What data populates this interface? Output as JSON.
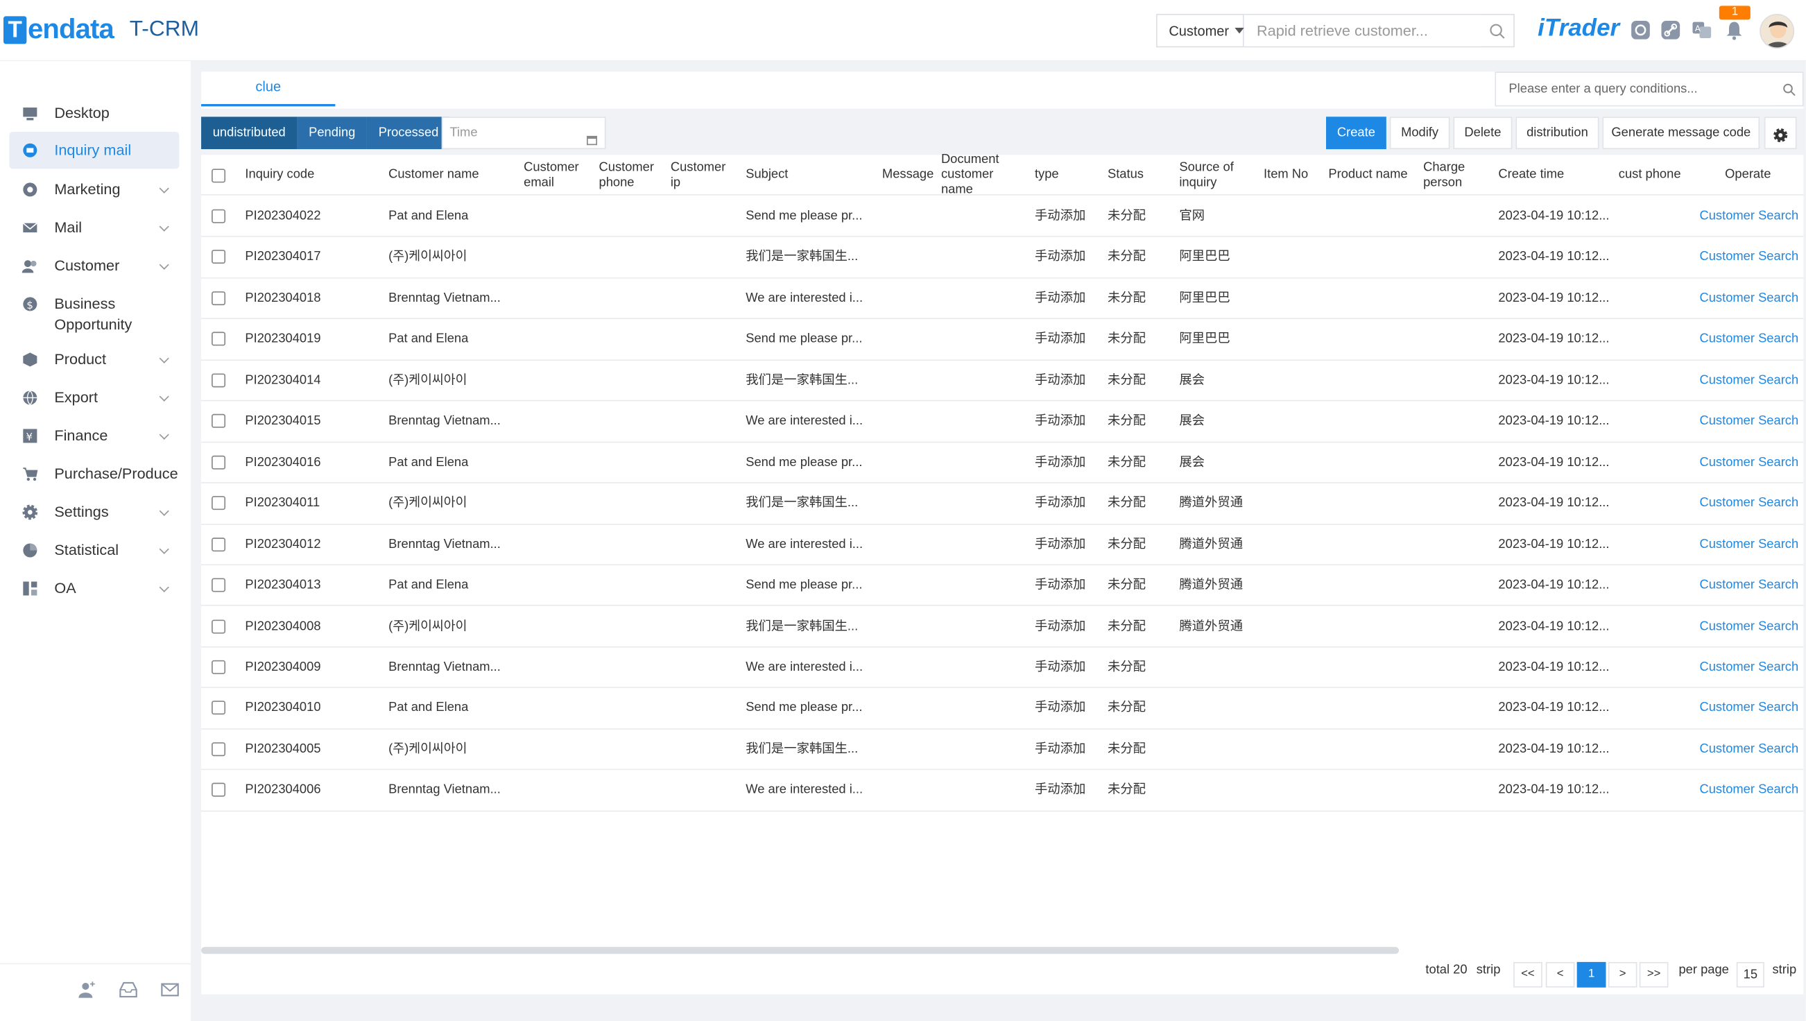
{
  "brand": {
    "logo_letter": "T",
    "logo_rest": "endata",
    "app_title": "T-CRM",
    "itrader": "iTrader",
    "notification_count": "1"
  },
  "search": {
    "type": "Customer",
    "placeholder": "Rapid retrieve customer..."
  },
  "sidebar": {
    "items": [
      {
        "label": "Desktop",
        "icon": "desktop-icon",
        "has_submenu": false
      },
      {
        "label": "Inquiry mail",
        "icon": "inquiry-icon",
        "has_submenu": false,
        "active": true
      },
      {
        "label": "Marketing",
        "icon": "marketing-icon",
        "has_submenu": true
      },
      {
        "label": "Mail",
        "icon": "mail-icon",
        "has_submenu": true
      },
      {
        "label": "Customer",
        "icon": "customer-icon",
        "has_submenu": true
      },
      {
        "label": "Business Opportunity",
        "icon": "business-icon",
        "has_submenu": false
      },
      {
        "label": "Product",
        "icon": "product-icon",
        "has_submenu": true
      },
      {
        "label": "Export",
        "icon": "export-icon",
        "has_submenu": true
      },
      {
        "label": "Finance",
        "icon": "finance-icon",
        "has_submenu": true
      },
      {
        "label": "Purchase/Produce",
        "icon": "cart-icon",
        "has_submenu": false
      },
      {
        "label": "Settings",
        "icon": "gear-icon",
        "has_submenu": true
      },
      {
        "label": "Statistical",
        "icon": "pie-chart-icon",
        "has_submenu": true
      },
      {
        "label": "OA",
        "icon": "oa-icon",
        "has_submenu": true
      }
    ]
  },
  "tabs": {
    "active": "clue"
  },
  "query": {
    "placeholder": "Please enter a query conditions..."
  },
  "filters": {
    "undistributed": "undistributed",
    "pending": "Pending",
    "processed": "Processed",
    "time_placeholder": "Time"
  },
  "actions": {
    "create": "Create",
    "modify": "Modify",
    "delete": "Delete",
    "distribution": "distribution",
    "generate": "Generate message code"
  },
  "table": {
    "headers": [
      "Inquiry code",
      "Customer name",
      "Customer email",
      "Customer phone",
      "Customer ip",
      "Subject",
      "Message",
      "Document customer name",
      "type",
      "Status",
      "Source of inquiry",
      "Item No",
      "Product name",
      "Charge person",
      "Create time",
      "cust phone",
      "Operate"
    ],
    "rows": [
      {
        "code": "PI202304022",
        "name": "Pat and Elena",
        "subject": "Send me please pr...",
        "type": "手动添加",
        "status": "未分配",
        "source": "官网",
        "time": "2023-04-19 10:12...",
        "op": "Customer Search"
      },
      {
        "code": "PI202304017",
        "name": "(주)케이씨아이",
        "subject": "我们是一家韩国生...",
        "type": "手动添加",
        "status": "未分配",
        "source": "阿里巴巴",
        "time": "2023-04-19 10:12...",
        "op": "Customer Search"
      },
      {
        "code": "PI202304018",
        "name": "Brenntag Vietnam...",
        "subject": "We are interested i...",
        "type": "手动添加",
        "status": "未分配",
        "source": "阿里巴巴",
        "time": "2023-04-19 10:12...",
        "op": "Customer Search"
      },
      {
        "code": "PI202304019",
        "name": "Pat and Elena",
        "subject": "Send me please pr...",
        "type": "手动添加",
        "status": "未分配",
        "source": "阿里巴巴",
        "time": "2023-04-19 10:12...",
        "op": "Customer Search"
      },
      {
        "code": "PI202304014",
        "name": "(주)케이씨아이",
        "subject": "我们是一家韩国生...",
        "type": "手动添加",
        "status": "未分配",
        "source": "展会",
        "time": "2023-04-19 10:12...",
        "op": "Customer Search"
      },
      {
        "code": "PI202304015",
        "name": "Brenntag Vietnam...",
        "subject": "We are interested i...",
        "type": "手动添加",
        "status": "未分配",
        "source": "展会",
        "time": "2023-04-19 10:12...",
        "op": "Customer Search"
      },
      {
        "code": "PI202304016",
        "name": "Pat and Elena",
        "subject": "Send me please pr...",
        "type": "手动添加",
        "status": "未分配",
        "source": "展会",
        "time": "2023-04-19 10:12...",
        "op": "Customer Search"
      },
      {
        "code": "PI202304011",
        "name": "(주)케이씨아이",
        "subject": "我们是一家韩国生...",
        "type": "手动添加",
        "status": "未分配",
        "source": "腾道外贸通",
        "time": "2023-04-19 10:12...",
        "op": "Customer Search"
      },
      {
        "code": "PI202304012",
        "name": "Brenntag Vietnam...",
        "subject": "We are interested i...",
        "type": "手动添加",
        "status": "未分配",
        "source": "腾道外贸通",
        "time": "2023-04-19 10:12...",
        "op": "Customer Search"
      },
      {
        "code": "PI202304013",
        "name": "Pat and Elena",
        "subject": "Send me please pr...",
        "type": "手动添加",
        "status": "未分配",
        "source": "腾道外贸通",
        "time": "2023-04-19 10:12...",
        "op": "Customer Search"
      },
      {
        "code": "PI202304008",
        "name": "(주)케이씨아이",
        "subject": "我们是一家韩国生...",
        "type": "手动添加",
        "status": "未分配",
        "source": "腾道外贸通",
        "time": "2023-04-19 10:12...",
        "op": "Customer Search"
      },
      {
        "code": "PI202304009",
        "name": "Brenntag Vietnam...",
        "subject": "We are interested i...",
        "type": "手动添加",
        "status": "未分配",
        "source": "",
        "time": "2023-04-19 10:12...",
        "op": "Customer Search"
      },
      {
        "code": "PI202304010",
        "name": "Pat and Elena",
        "subject": "Send me please pr...",
        "type": "手动添加",
        "status": "未分配",
        "source": "",
        "time": "2023-04-19 10:12...",
        "op": "Customer Search"
      },
      {
        "code": "PI202304005",
        "name": "(주)케이씨아이",
        "subject": "我们是一家韩国生...",
        "type": "手动添加",
        "status": "未分配",
        "source": "",
        "time": "2023-04-19 10:12...",
        "op": "Customer Search"
      },
      {
        "code": "PI202304006",
        "name": "Brenntag Vietnam...",
        "subject": "We are interested i...",
        "type": "手动添加",
        "status": "未分配",
        "source": "",
        "time": "2023-04-19 10:12...",
        "op": "Customer Search"
      }
    ]
  },
  "pagination": {
    "total": "total 20",
    "strip": "strip",
    "first": "<<",
    "prev": "<",
    "current": "1",
    "next": ">",
    "last": ">>",
    "per_page": "per page",
    "size": "15",
    "strip2": "strip"
  },
  "colors": {
    "accent": "#1e88e5",
    "segment": "#2a6fab"
  }
}
